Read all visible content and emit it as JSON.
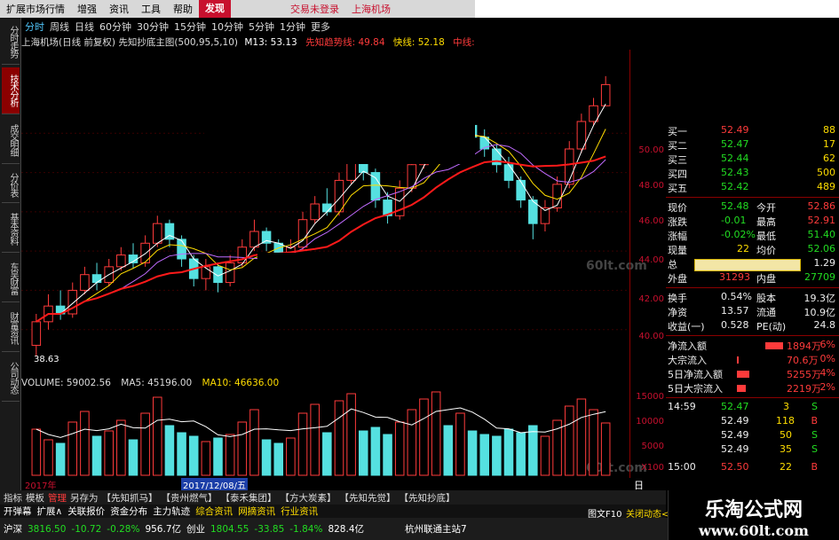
{
  "menu": {
    "items": [
      "扩展市场行情",
      "增强",
      "资讯",
      "工具",
      "帮助"
    ],
    "active": "发现",
    "account": "交易未登录",
    "stock_name": "上海机场"
  },
  "side_tabs": [
    "分时走势",
    "技术分析",
    "成交明细",
    "分价表",
    "基本资料",
    "东吴财富",
    "财富资讯",
    "公司动态"
  ],
  "periods": [
    "分时",
    "周线",
    "日线",
    "60分钟",
    "30分钟",
    "15分钟",
    "10分钟",
    "5分钟",
    "1分钟",
    "更多"
  ],
  "chart_title": "上海机场(日线 前复权) 先知抄底主图(500,95,5,10)",
  "indicators": [
    {
      "label": "M13: 53.13",
      "color": "#ffffff"
    },
    {
      "label": "先知趋势线: 49.84",
      "color": "#ff3b3b"
    },
    {
      "label": "快线: 52.18",
      "color": "#ffdd00"
    },
    {
      "label": "中线: 52.4",
      "color": "#ff3b3b"
    }
  ],
  "price_low_label": "38.63",
  "y_ticks": [
    "50.00",
    "48.00",
    "46.00",
    "44.00",
    "42.00",
    "40.00"
  ],
  "vol_ticks": [
    "15000",
    "10000",
    "5000",
    "X100"
  ],
  "watermark": "60lt.com",
  "volume_header": {
    "volume": "VOLUME: 59002.56",
    "ma5": "MA5: 45196.00",
    "ma10": "MA10: 46636.00"
  },
  "date_bar": {
    "start": "2017年",
    "cursor": "2017/12/08/五",
    "end_label": "日线"
  },
  "quote": {
    "bids": [
      {
        "label": "买一",
        "price": "52.49",
        "vol": "88"
      },
      {
        "label": "买二",
        "price": "52.47",
        "vol": "17"
      },
      {
        "label": "买三",
        "price": "52.44",
        "vol": "62"
      },
      {
        "label": "买四",
        "price": "52.43",
        "vol": "500"
      },
      {
        "label": "买五",
        "price": "52.42",
        "vol": "489"
      }
    ],
    "stats": [
      {
        "l1": "现价",
        "v1": "52.48",
        "l2": "今开",
        "v2": "52.86"
      },
      {
        "l1": "涨跌",
        "v1": "-0.01",
        "l2": "最高",
        "v2": "52.91"
      },
      {
        "l1": "涨幅",
        "v1": "-0.02%",
        "l2": "最低",
        "v2": "51.40"
      },
      {
        "l1": "现量",
        "v1": "22",
        "l2": "均价",
        "v2": "52.06"
      },
      {
        "l1": "总",
        "v1": "",
        "l2": "",
        "v2": "1.29"
      },
      {
        "l1": "外盘",
        "v1": "31293",
        "l2": "内盘",
        "v2": "27709"
      },
      {
        "l1": "换手",
        "v1": "0.54%",
        "l2": "股本",
        "v2": "19.3亿"
      },
      {
        "l1": "净资",
        "v1": "13.57",
        "l2": "流通",
        "v2": "10.9亿"
      },
      {
        "l1": "收益(一)",
        "v1": "0.528",
        "l2": "PE(动)",
        "v2": "24.8"
      }
    ],
    "flows": [
      {
        "label": "净流入额",
        "value": "1894万",
        "pct": "6%"
      },
      {
        "label": "大宗流入",
        "value": "70.6万",
        "pct": "0%"
      },
      {
        "label": "5日净流入额",
        "value": "5255万",
        "pct": "4%"
      },
      {
        "label": "5日大宗流入",
        "value": "2219万",
        "pct": "2%"
      }
    ],
    "ticks": [
      {
        "time": "14:59",
        "price": "52.47",
        "vol": "3",
        "side": "S"
      },
      {
        "time": "",
        "price": "52.49",
        "vol": "118",
        "side": "B"
      },
      {
        "time": "",
        "price": "52.49",
        "vol": "50",
        "side": "S"
      },
      {
        "time": "",
        "price": "52.49",
        "vol": "35",
        "side": "S"
      },
      {
        "time": "15:00",
        "price": "52.50",
        "vol": "22",
        "side": "B"
      }
    ]
  },
  "bottom_tabs": [
    "指标",
    "模板",
    "管理",
    "另存为",
    "【先知抓马】",
    "【贵州燃气】",
    "【泰禾集团】",
    "【方大炭素】",
    "【先知先觉】",
    "【先知抄底】"
  ],
  "sub_tabs": [
    "开弹幕",
    "扩展∧",
    "关联报价",
    "资金分布",
    "主力轨迹",
    "综合资讯",
    "网摘资讯",
    "行业资讯"
  ],
  "status": {
    "sh_label": "沪深",
    "sh_value": "3816.50",
    "sh_change": "-10.72",
    "sh_pct": "-0.28%",
    "sh_amount": "956.7亿",
    "cy_label": "创业",
    "cy_value": "1804.55",
    "cy_change": "-33.85",
    "cy_pct": "-1.84%",
    "cy_amount": "828.4亿",
    "site": "杭州联通主站7",
    "f10": "图文F10",
    "toggle": "关闭动态<"
  },
  "brand": {
    "name": "乐淘公式网",
    "url": "www.60lt.com"
  },
  "chart_data": {
    "type": "candlestick",
    "title": "上海机场(日线 前复权)",
    "y_range": [
      38,
      52
    ],
    "candles": [
      {
        "o": 39.2,
        "c": 40.4,
        "h": 40.8,
        "l": 38.63
      },
      {
        "o": 40.4,
        "c": 41.2,
        "h": 41.8,
        "l": 40.0
      },
      {
        "o": 41.2,
        "c": 40.8,
        "h": 42.0,
        "l": 40.5
      },
      {
        "o": 40.8,
        "c": 42.0,
        "h": 42.4,
        "l": 40.6
      },
      {
        "o": 42.0,
        "c": 42.8,
        "h": 43.2,
        "l": 41.8
      },
      {
        "o": 42.8,
        "c": 42.4,
        "h": 43.4,
        "l": 42.0
      },
      {
        "o": 42.4,
        "c": 43.2,
        "h": 43.6,
        "l": 42.2
      },
      {
        "o": 43.2,
        "c": 43.8,
        "h": 44.2,
        "l": 43.0
      },
      {
        "o": 43.8,
        "c": 43.4,
        "h": 44.4,
        "l": 43.1
      },
      {
        "o": 43.4,
        "c": 44.4,
        "h": 44.8,
        "l": 43.2
      },
      {
        "o": 44.4,
        "c": 45.4,
        "h": 45.8,
        "l": 44.2
      },
      {
        "o": 45.4,
        "c": 44.6,
        "h": 45.6,
        "l": 44.2
      },
      {
        "o": 44.6,
        "c": 43.6,
        "h": 44.8,
        "l": 43.2
      },
      {
        "o": 43.6,
        "c": 42.6,
        "h": 43.8,
        "l": 42.2
      },
      {
        "o": 42.6,
        "c": 43.2,
        "h": 43.6,
        "l": 42.0
      },
      {
        "o": 43.2,
        "c": 42.4,
        "h": 43.4,
        "l": 41.9
      },
      {
        "o": 42.4,
        "c": 43.4,
        "h": 43.8,
        "l": 42.2
      },
      {
        "o": 43.4,
        "c": 44.2,
        "h": 44.6,
        "l": 43.2
      },
      {
        "o": 44.2,
        "c": 45.0,
        "h": 45.6,
        "l": 44.0
      },
      {
        "o": 45.0,
        "c": 44.4,
        "h": 45.2,
        "l": 44.0
      },
      {
        "o": 44.4,
        "c": 43.8,
        "h": 44.6,
        "l": 43.4
      },
      {
        "o": 43.8,
        "c": 44.2,
        "h": 44.6,
        "l": 43.6
      },
      {
        "o": 44.2,
        "c": 45.6,
        "h": 46.0,
        "l": 44.0
      },
      {
        "o": 45.6,
        "c": 46.4,
        "h": 46.8,
        "l": 45.4
      },
      {
        "o": 46.4,
        "c": 46.0,
        "h": 47.2,
        "l": 45.8
      },
      {
        "o": 46.0,
        "c": 47.6,
        "h": 48.0,
        "l": 45.8
      },
      {
        "o": 47.6,
        "c": 48.6,
        "h": 49.0,
        "l": 47.4
      },
      {
        "o": 48.6,
        "c": 48.0,
        "h": 49.0,
        "l": 47.6
      },
      {
        "o": 48.0,
        "c": 46.6,
        "h": 48.2,
        "l": 46.2
      },
      {
        "o": 46.6,
        "c": 45.8,
        "h": 47.0,
        "l": 45.4
      },
      {
        "o": 45.8,
        "c": 47.2,
        "h": 47.6,
        "l": 45.6
      },
      {
        "o": 47.2,
        "c": 48.4,
        "h": 48.8,
        "l": 47.0
      },
      {
        "o": 48.4,
        "c": 49.4,
        "h": 49.8,
        "l": 48.2
      },
      {
        "o": 49.4,
        "c": 50.2,
        "h": 50.6,
        "l": 49.2
      },
      {
        "o": 50.2,
        "c": 49.6,
        "h": 50.6,
        "l": 49.2
      },
      {
        "o": 49.6,
        "c": 50.4,
        "h": 51.0,
        "l": 49.4
      },
      {
        "o": 50.4,
        "c": 49.8,
        "h": 50.8,
        "l": 49.4
      },
      {
        "o": 49.8,
        "c": 49.2,
        "h": 50.2,
        "l": 48.8
      },
      {
        "o": 49.2,
        "c": 48.4,
        "h": 49.4,
        "l": 48.0
      },
      {
        "o": 48.4,
        "c": 47.6,
        "h": 48.8,
        "l": 47.2
      },
      {
        "o": 47.6,
        "c": 46.6,
        "h": 47.8,
        "l": 46.2
      },
      {
        "o": 46.6,
        "c": 45.4,
        "h": 46.8,
        "l": 44.6
      },
      {
        "o": 45.4,
        "c": 46.2,
        "h": 46.6,
        "l": 45.0
      },
      {
        "o": 46.2,
        "c": 47.4,
        "h": 47.8,
        "l": 46.0
      },
      {
        "o": 47.4,
        "c": 49.2,
        "h": 49.6,
        "l": 47.2
      },
      {
        "o": 49.2,
        "c": 50.6,
        "h": 51.0,
        "l": 49.0
      },
      {
        "o": 50.6,
        "c": 51.4,
        "h": 51.8,
        "l": 50.4
      },
      {
        "o": 51.4,
        "c": 52.48,
        "h": 52.91,
        "l": 51.4
      }
    ],
    "volume": [
      52,
      40,
      36,
      60,
      72,
      44,
      50,
      62,
      40,
      70,
      88,
      56,
      48,
      44,
      38,
      42,
      46,
      60,
      74,
      40,
      36,
      42,
      70,
      80,
      48,
      84,
      92,
      50,
      54,
      46,
      60,
      74,
      86,
      94,
      56,
      70,
      50,
      46,
      44,
      52,
      48,
      56,
      44,
      62,
      78,
      86,
      74,
      59
    ]
  }
}
